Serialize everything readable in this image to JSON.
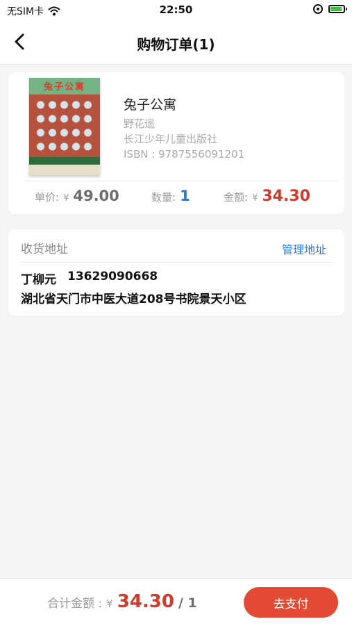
{
  "status_bar": {
    "carrier": "无SIM卡",
    "time": "22:50"
  },
  "nav": {
    "title": "购物订单(1)"
  },
  "product": {
    "cover_title": "兔子公寓",
    "title": "兔子公寓",
    "author": "野花遥",
    "publisher": "长江少年儿童出版社",
    "isbn": "ISBN : 9787556091201",
    "unit_price_label": "单价:",
    "unit_price_currency": "¥",
    "unit_price": "49.00",
    "quantity_label": "数量:",
    "quantity": "1",
    "amount_label": "金额:",
    "amount_currency": "¥",
    "amount": "34.30"
  },
  "address": {
    "header": "收货地址",
    "manage_label": "管理地址",
    "name": "丁柳元",
    "phone": "13629090668",
    "line": "湖北省天门市中医大道208号书院景天小区"
  },
  "footer": {
    "total_label": "合计金额 :",
    "currency": "¥",
    "total": "34.30",
    "count": "/ 1",
    "pay_label": "去支付"
  },
  "colors": {
    "accent_red": "#e24a34",
    "price_red": "#d23a2c",
    "link_blue": "#2a7ee0"
  }
}
